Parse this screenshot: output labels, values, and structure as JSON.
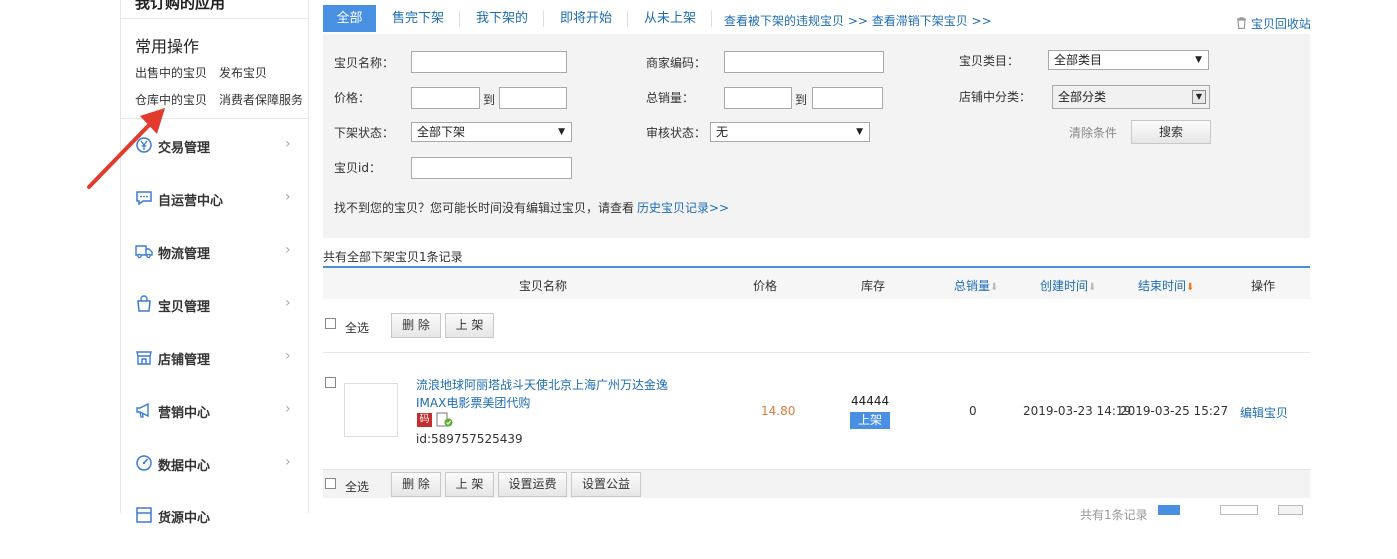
{
  "sidebar": {
    "cut_title": "我订购的应用",
    "common_title": "常用操作",
    "links": [
      "出售中的宝贝",
      "发布宝贝",
      "仓库中的宝贝",
      "消费者保障服务"
    ],
    "nav": [
      {
        "label": "交易管理",
        "icon": "yen-circle-icon"
      },
      {
        "label": "自运营中心",
        "icon": "chat-bubble-icon"
      },
      {
        "label": "物流管理",
        "icon": "truck-icon"
      },
      {
        "label": "宝贝管理",
        "icon": "bag-icon"
      },
      {
        "label": "店铺管理",
        "icon": "store-icon"
      },
      {
        "label": "营销中心",
        "icon": "megaphone-icon"
      },
      {
        "label": "数据中心",
        "icon": "gauge-icon"
      },
      {
        "label": "货源中心",
        "icon": "box-icon"
      }
    ],
    "arrow_glyph": "›"
  },
  "tabs": [
    "全部",
    "售完下架",
    "我下架的",
    "即将开始",
    "从未上架"
  ],
  "tab_links": "查看被下架的违规宝贝 >> 查看滞销下架宝贝 >>",
  "recycle_bin": "宝贝回收站",
  "filters": {
    "name_label": "宝贝名称：",
    "merchant_code_label": "商家编码：",
    "category_label": "宝贝类目：",
    "category_value": "全部类目",
    "price_label": "价格：",
    "to": "到",
    "total_sales_label": "总销量：",
    "shop_category_label": "店铺中分类：",
    "shop_category_value": "全部分类",
    "delist_status_label": "下架状态：",
    "delist_status_value": "全部下架",
    "audit_status_label": "审核状态：",
    "audit_status_value": "无",
    "clear_label": "清除条件",
    "search_label": "搜索",
    "item_id_label": "宝贝id：",
    "hint_text": "找不到您的宝贝？您可能长时间没有编辑过宝贝，请查看",
    "history_link": "历史宝贝记录>>"
  },
  "summary": "共有全部下架宝贝1条记录",
  "table": {
    "headers": [
      "宝贝名称",
      "价格",
      "库存",
      "总销量",
      "创建时间",
      "结束时间",
      "操作"
    ],
    "select_all": "全选",
    "delete_label": "删 除",
    "list_label": "上 架",
    "shipping_label": "设置运费",
    "charity_label": "设置公益",
    "rows": [
      {
        "title_line1": "流浪地球阿丽塔战斗天使北京上海广州万达金逸",
        "title_line2": "IMAX电影票美团代购",
        "code_badge": "码",
        "item_id": "id:589757525439",
        "price": "14.80",
        "stock": "44444",
        "list_button": "上架",
        "total_sales": "0",
        "created": "2019-03-23 14:19",
        "ends": "2019-03-25 15:27",
        "action": "编辑宝贝"
      }
    ]
  },
  "pagination_text": "共有1条记录"
}
